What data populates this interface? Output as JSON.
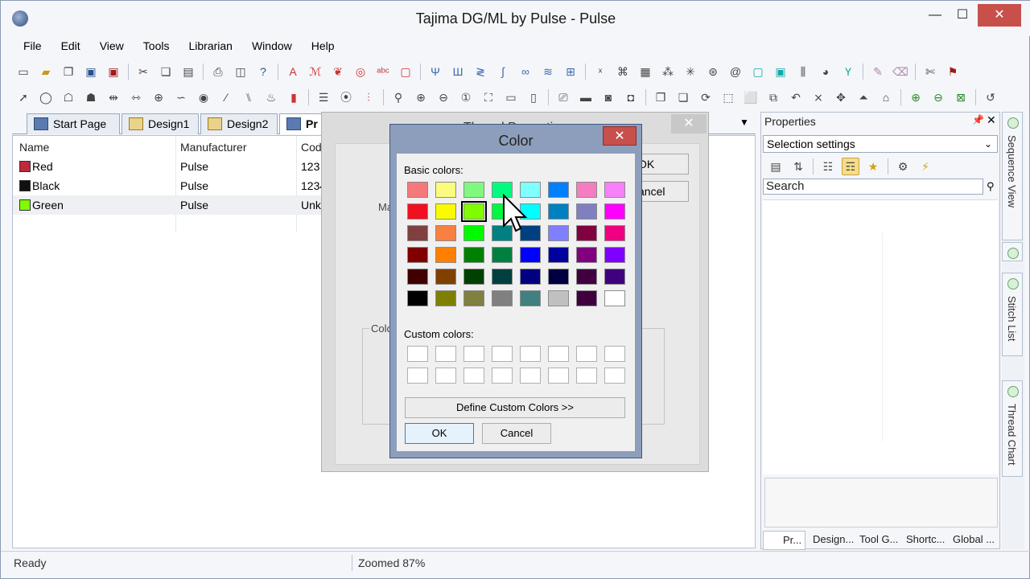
{
  "window": {
    "title": "Tajima DG/ML by Pulse - Pulse",
    "minimize_glyph": "—",
    "maximize_glyph": "☐",
    "close_glyph": "✕"
  },
  "menu": [
    "File",
    "Edit",
    "View",
    "Tools",
    "Librarian",
    "Window",
    "Help"
  ],
  "tabs": [
    {
      "label": "Start Page"
    },
    {
      "label": "Design1"
    },
    {
      "label": "Design2"
    },
    {
      "label": "Pr"
    }
  ],
  "thread_list": {
    "columns": [
      "Name",
      "Manufacturer",
      "Cod"
    ],
    "rows": [
      {
        "name": "Red",
        "manufacturer": "Pulse",
        "code": "123",
        "swatch": "#c0283c"
      },
      {
        "name": "Black",
        "manufacturer": "Pulse",
        "code": "1234",
        "swatch": "#111111"
      },
      {
        "name": "Green",
        "manufacturer": "Pulse",
        "code": "Unk",
        "swatch": "#7ffc00"
      }
    ]
  },
  "thread_dialog": {
    "title": "Thread Properties",
    "ok": "OK",
    "cancel": "ancel",
    "ma_label": "Ma",
    "color_group": "Colo"
  },
  "color_dialog": {
    "title": "Color",
    "close_glyph": "✕",
    "basic_label": "Basic colors:",
    "custom_label": "Custom colors:",
    "define_button": "Define Custom Colors >>",
    "ok": "OK",
    "cancel": "Cancel",
    "selected_index": 10,
    "basic_colors": [
      "#f4787c",
      "#fbfb80",
      "#80f880",
      "#00fb80",
      "#80ffff",
      "#0080ff",
      "#f47cc0",
      "#f880f8",
      "#f01020",
      "#fbfb00",
      "#80fc00",
      "#00f840",
      "#00ffff",
      "#0080c0",
      "#8080c0",
      "#ff00ff",
      "#804040",
      "#f88040",
      "#00fb00",
      "#008080",
      "#004080",
      "#8080ff",
      "#800040",
      "#f00080",
      "#800000",
      "#ff8000",
      "#008000",
      "#008040",
      "#0000ff",
      "#0000a0",
      "#800080",
      "#8000ff",
      "#400000",
      "#804000",
      "#004000",
      "#004040",
      "#000080",
      "#000040",
      "#400040",
      "#400080",
      "#000000",
      "#808000",
      "#808040",
      "#808080",
      "#408080",
      "#c0c0c0",
      "#400040",
      "#ffffff"
    ]
  },
  "properties": {
    "title": "Properties",
    "pin_glyph": "📌",
    "close_glyph": "✕",
    "selector": "Selection settings",
    "search_placeholder": "Search",
    "tabs": [
      "Pr...",
      "Design...",
      "Tool G...",
      "Shortc...",
      "Global ..."
    ]
  },
  "side_rail": [
    "Sequence View",
    "Stitch List",
    "Thread Chart"
  ],
  "status": {
    "ready": "Ready",
    "zoom": "Zoomed 87%"
  }
}
